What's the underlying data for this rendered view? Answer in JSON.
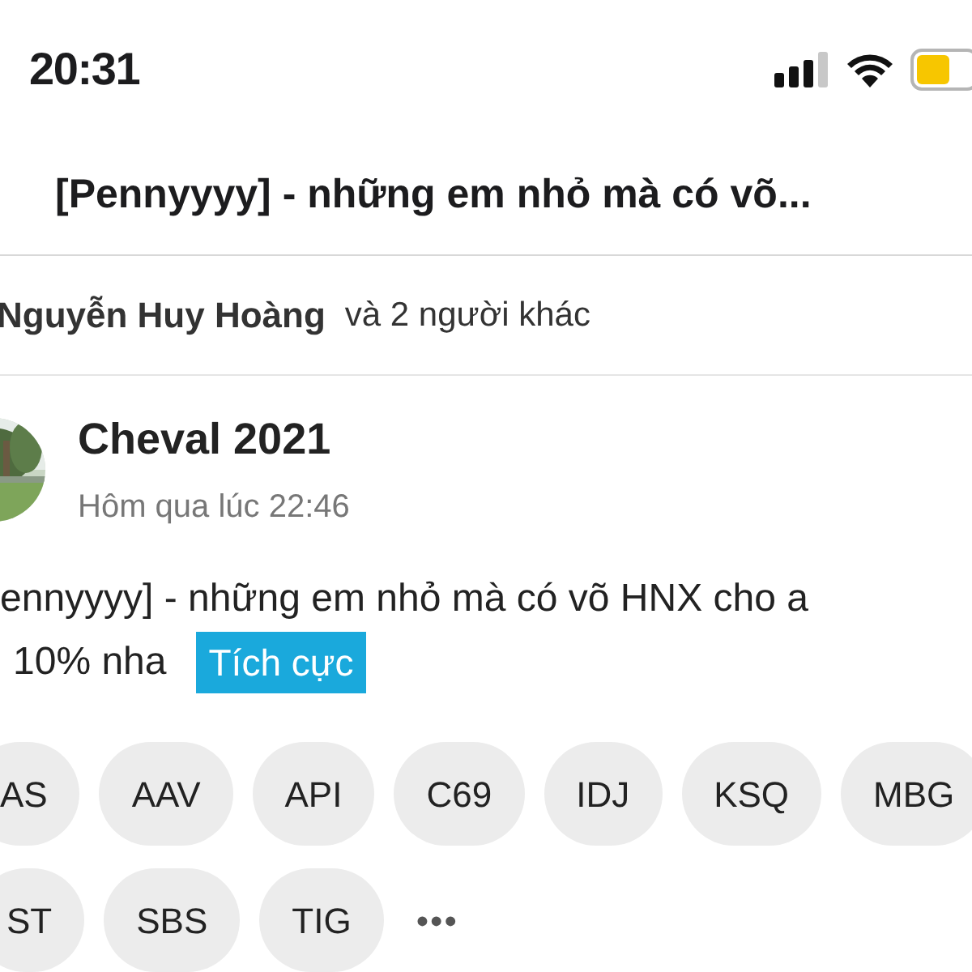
{
  "status_bar": {
    "time": "20:31"
  },
  "header": {
    "title": "[Pennyyyy] - những em nhỏ mà có võ..."
  },
  "reactions": {
    "name": "Nguyễn Huy Hoàng",
    "others": "và 2 người khác"
  },
  "post": {
    "author": "Cheval 2021",
    "time": "Hôm qua lúc 22:46",
    "lines": [
      "ennyyyy] - những em nhỏ mà có võ HNX cho a",
      "10% nha"
    ],
    "sentiment": "Tích cực",
    "ticker_rows": [
      [
        "AS",
        "AAV",
        "API",
        "C69",
        "IDJ",
        "KSQ",
        "MBG"
      ],
      [
        "ST",
        "SBS",
        "TIG"
      ]
    ],
    "more": "•••"
  }
}
